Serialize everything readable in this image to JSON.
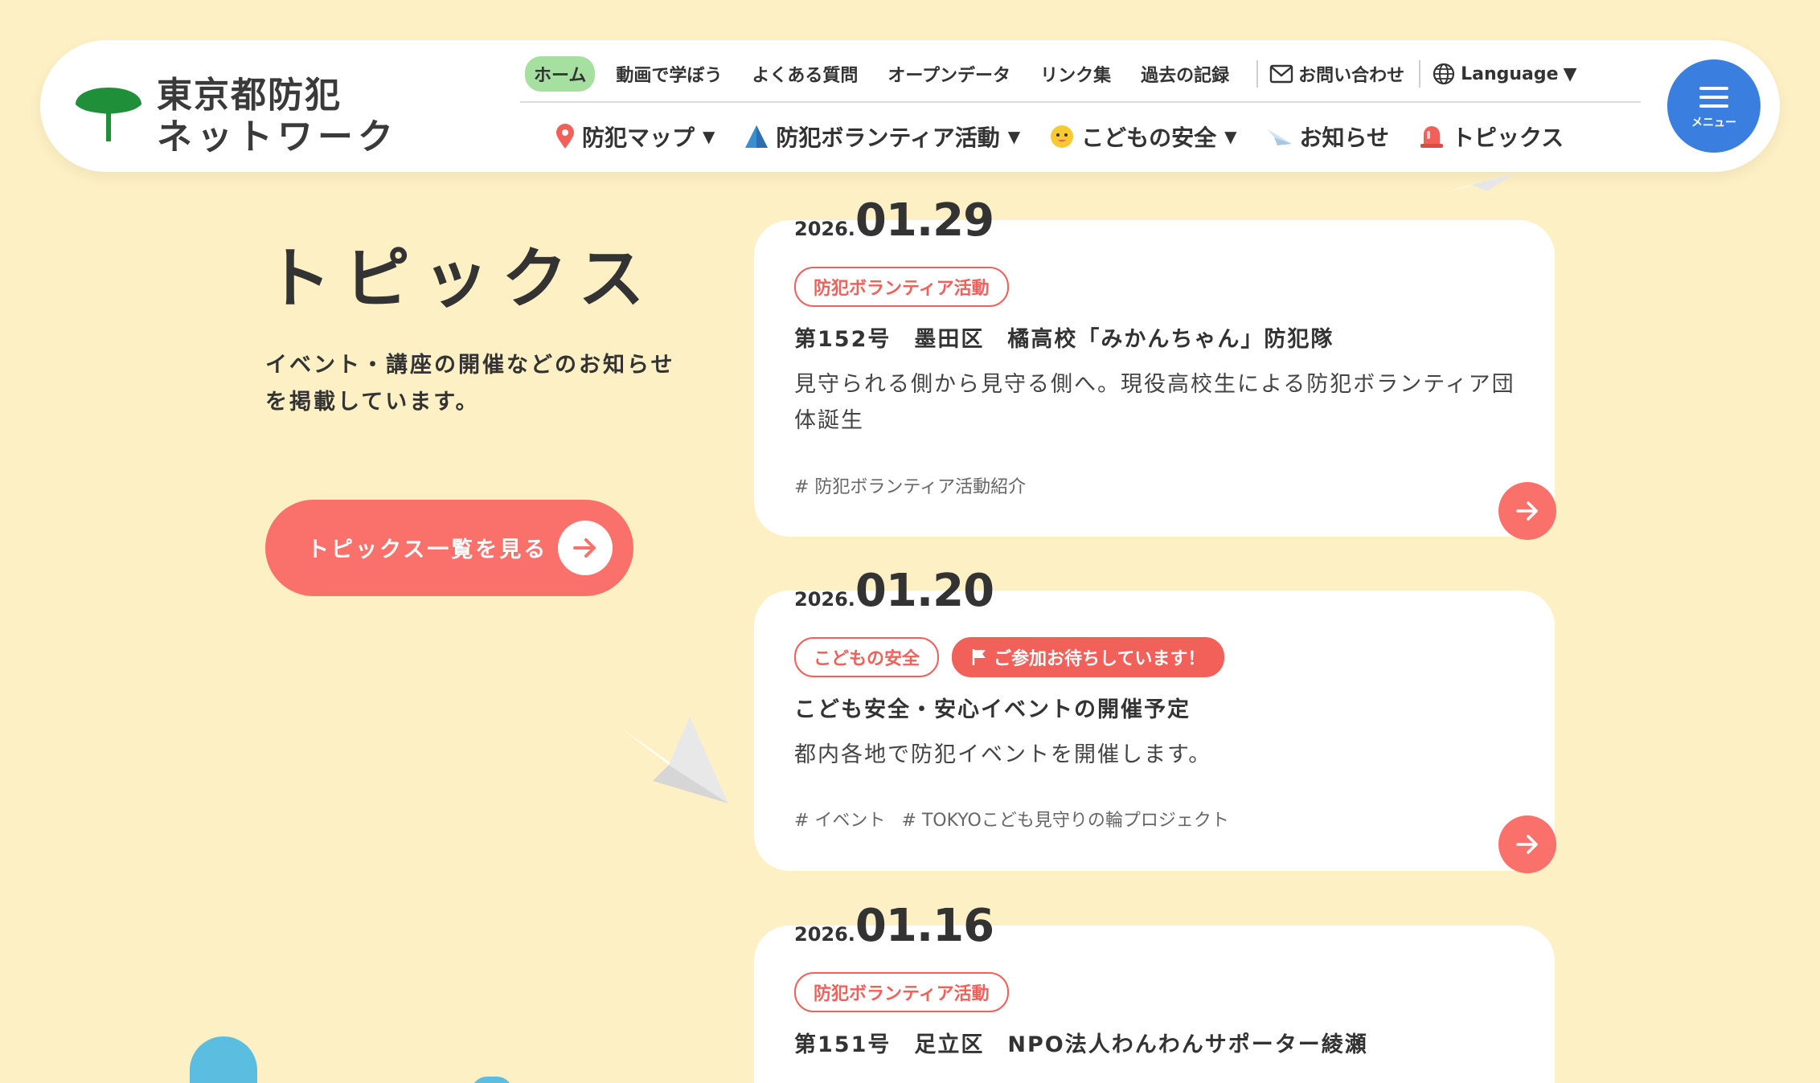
{
  "logo": {
    "line1": "東京都防犯",
    "line2": "ネットワーク"
  },
  "header": {
    "subnav": [
      "ホーム",
      "動画で学ぼう",
      "よくある質問",
      "オープンデータ",
      "リンク集",
      "過去の記録"
    ],
    "contact": "お問い合わせ",
    "language": "Language",
    "mainnav": [
      {
        "label": "防犯マップ",
        "icon": "map-pin-icon",
        "has_dropdown": true
      },
      {
        "label": "防犯ボランティア活動",
        "icon": "triangle-flag-icon",
        "has_dropdown": true
      },
      {
        "label": "こどもの安全",
        "icon": "child-face-icon",
        "has_dropdown": true
      },
      {
        "label": "お知らせ",
        "icon": "paper-plane-icon",
        "has_dropdown": false
      },
      {
        "label": "トピックス",
        "icon": "alarm-light-icon",
        "has_dropdown": false
      }
    ],
    "menu_label": "メニュー"
  },
  "page": {
    "title": "トピックス",
    "description": "イベント・講座の開催などのお知らせを掲載しています。",
    "list_button": "トピックス一覧を見る"
  },
  "cards": [
    {
      "year": "2026.",
      "date": "01.29",
      "tags": [
        {
          "label": "防犯ボランティア活動",
          "filled": false
        }
      ],
      "title": "第152号　墨田区　橘高校「みかんちゃん」防犯隊",
      "body": "見守られる側から見守る側へ。現役高校生による防犯ボランティア団体誕生",
      "hashtags": [
        "# 防犯ボランティア活動紹介"
      ]
    },
    {
      "year": "2026.",
      "date": "01.20",
      "tags": [
        {
          "label": "こどもの安全",
          "filled": false
        },
        {
          "label": "ご参加お待ちしています！",
          "filled": true
        }
      ],
      "title": "こども安全・安心イベントの開催予定",
      "body": "都内各地で防犯イベントを開催します。",
      "hashtags": [
        "# イベント",
        "# TOKYOこども見守りの輪プロジェクト"
      ]
    },
    {
      "year": "2026.",
      "date": "01.16",
      "tags": [
        {
          "label": "防犯ボランティア活動",
          "filled": false
        }
      ],
      "title": "第151号　足立区　NPO法人わんわんサポーター綾瀬",
      "body": "",
      "hashtags": []
    }
  ],
  "colors": {
    "background": "#fdf0c4",
    "accent": "#fa706a",
    "menu_button": "#3a7fe0",
    "active_nav": "#a6e0a0"
  }
}
